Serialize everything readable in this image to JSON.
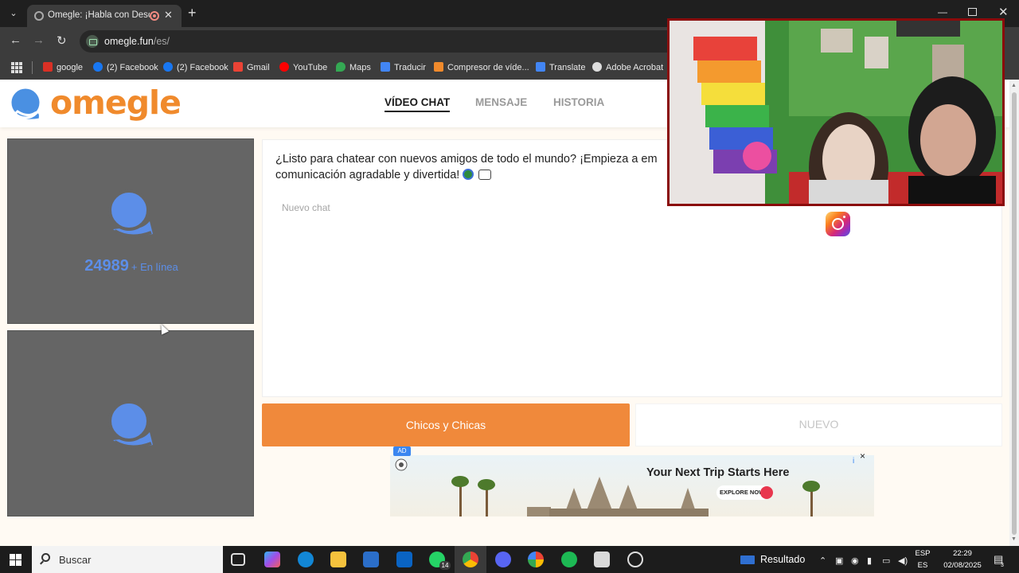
{
  "browser": {
    "tab_title": "Omegle: ¡Habla con Descon",
    "url_host": "omegle.fun",
    "url_path": "/es/",
    "bookmarks": [
      {
        "label": "google",
        "icon": "google-icon",
        "color": "#d93025"
      },
      {
        "label": "(2) Facebook",
        "icon": "facebook-icon",
        "color": "#1877f2"
      },
      {
        "label": "(2) Facebook",
        "icon": "facebook-icon",
        "color": "#1877f2"
      },
      {
        "label": "Gmail",
        "icon": "gmail-icon",
        "color": "#ea4335"
      },
      {
        "label": "YouTube",
        "icon": "youtube-icon",
        "color": "#ff0000"
      },
      {
        "label": "Maps",
        "icon": "maps-pin-icon",
        "color": "#34a853"
      },
      {
        "label": "Traducir",
        "icon": "translate-icon",
        "color": "#4285f4"
      },
      {
        "label": "Compresor de víde...",
        "icon": "compressor-icon",
        "color": "#f08a2c"
      },
      {
        "label": "Translate",
        "icon": "translate-icon",
        "color": "#4285f4"
      },
      {
        "label": "Adobe Acrobat",
        "icon": "globe-icon",
        "color": "#dddddd"
      }
    ]
  },
  "site": {
    "logo_text": "omegle",
    "nav": [
      {
        "label": "VÍDEO CHAT",
        "active": true
      },
      {
        "label": "MENSAJE",
        "active": false
      },
      {
        "label": "HISTORIA",
        "active": false
      }
    ],
    "online_count": "24989",
    "online_label": "+ En línea",
    "chat_intro": "¿Listo para chatear con nuevos amigos de todo el mundo? ¡Empieza a em",
    "chat_intro_line2": "comunicación agradable y divertida!",
    "chat_placeholder": "Nuevo chat",
    "gender_button": "Chicos y Chicas",
    "new_button": "NUEVO",
    "brand_color": "#f0893b",
    "accent_blue": "#5c8ee8"
  },
  "ad": {
    "badge": "AD",
    "headline": "Your Next Trip Starts Here",
    "cta": "EXPLORE NOW!",
    "close": "×",
    "info": "i"
  },
  "taskbar": {
    "search_label": "Buscar",
    "whatsapp_badge": "14",
    "weather_label": "Resultado",
    "lang_top": "ESP",
    "lang_bottom": "ES",
    "time": "22:29",
    "date": "02/08/2025",
    "notification_count": "3"
  }
}
